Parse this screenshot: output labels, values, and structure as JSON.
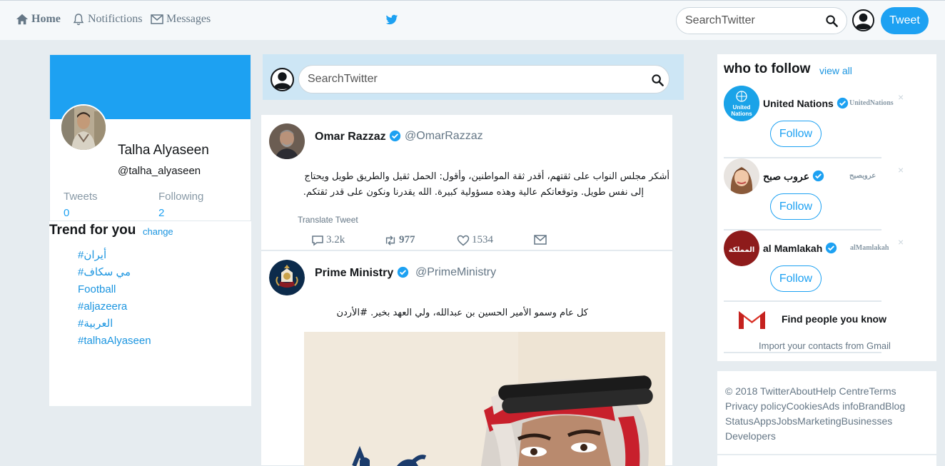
{
  "nav": {
    "home": "Home",
    "notifications": "Notifictions",
    "messages": "Messages",
    "search_placeholder": "SearchTwitter",
    "tweet_button": "Tweet"
  },
  "profile": {
    "name": "Talha Alyaseen",
    "handle": "@talha_alyaseen",
    "tweets_label": "Tweets",
    "tweets_count": "0",
    "following_label": "Following",
    "following_count": "2"
  },
  "trends": {
    "title": "Trend for you",
    "change": "change",
    "items": [
      "#أيران",
      "#مي سكاف",
      "Football",
      "#aljazeera",
      "#العربية",
      "#talhaAlyaseen"
    ]
  },
  "center": {
    "search_placeholder": "SearchTwitter"
  },
  "tweets": [
    {
      "name": "Omar Razzaz",
      "handle": "@OmarRazzaz",
      "text_line1": "أشكر مجلس النواب على ثقتهم، أقدر ثقة المواطنين، وأقول: الحمل ثقيل والطريق طويل ويحتاج",
      "text_line2": "إلى نفس طويل. وتوقعاتكم عالية وهذه مسؤولية كبيرة. الله يقدرنا ونكون على قدر ثقتكم.",
      "translate": "Translate Tweet",
      "replies": "3.2k",
      "retweets": "977",
      "likes": "1534"
    },
    {
      "name": "Prime Ministry",
      "handle": "@PrimeMinistry",
      "text_line1": "كل عام وسمو الأمير الحسين بن عبدالله، ولي العهد بخير. #الأردن"
    }
  ],
  "who_to_follow": {
    "title": "who to follow",
    "view_all": "view all",
    "follow_label": "Follow",
    "accounts": [
      {
        "name": "United Nations",
        "handle": "UnitedNations"
      },
      {
        "name": "عروب صبح",
        "handle": "عروبصبح"
      },
      {
        "name": "al Mamlakah",
        "handle": "alMamlakah"
      }
    ],
    "un_logo_line1": "United",
    "un_logo_line2": "Nations",
    "mamlakah_logo": "المملكة",
    "find_people": "Find people you know",
    "import": "Import your contacts from Gmail"
  },
  "footer": {
    "text": "© 2018 TwitterAboutHelp CentreTerms Privacy policyCookiesAds infoBrandBlog StatusAppsJobsMarketingBusinesses Developers"
  },
  "colors": {
    "accent": "#1da1f2",
    "link": "#1b95e0",
    "background": "#e6ecf0"
  }
}
